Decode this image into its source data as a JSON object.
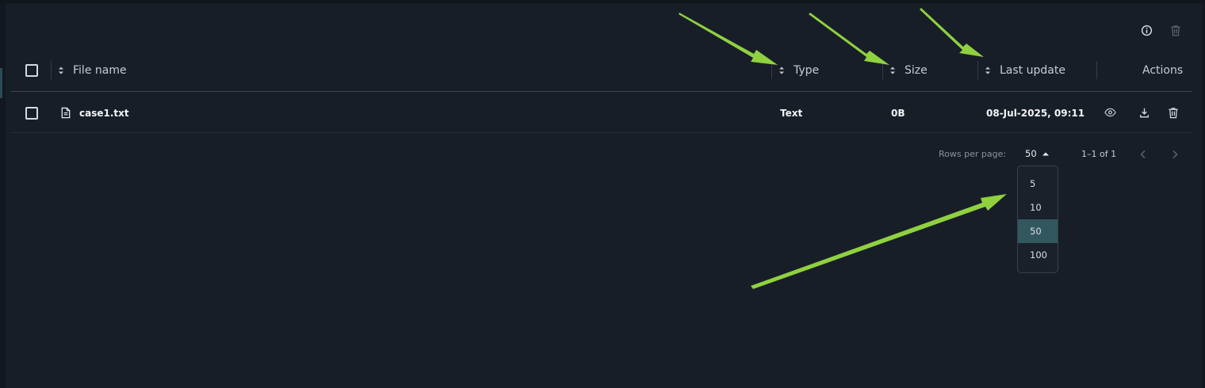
{
  "table": {
    "columns": {
      "file_name": "File name",
      "type": "Type",
      "size": "Size",
      "last_update": "Last update",
      "actions": "Actions"
    },
    "rows": [
      {
        "file_name": "case1.txt",
        "type": "Text",
        "size": "0B",
        "last_update": "08-Jul-2025, 09:11"
      }
    ]
  },
  "toolbar": {
    "icons": [
      "info-icon",
      "trash-icon"
    ]
  },
  "pagination": {
    "rows_per_page_label": "Rows per page:",
    "rows_per_page_value": "50",
    "range_label": "1–1 of 1",
    "options": [
      "5",
      "10",
      "50",
      "100"
    ],
    "selected_option": "50"
  },
  "colors": {
    "background": "#181e28",
    "selected_option": "#33575f",
    "annotation_arrow": "#8fd13f"
  }
}
